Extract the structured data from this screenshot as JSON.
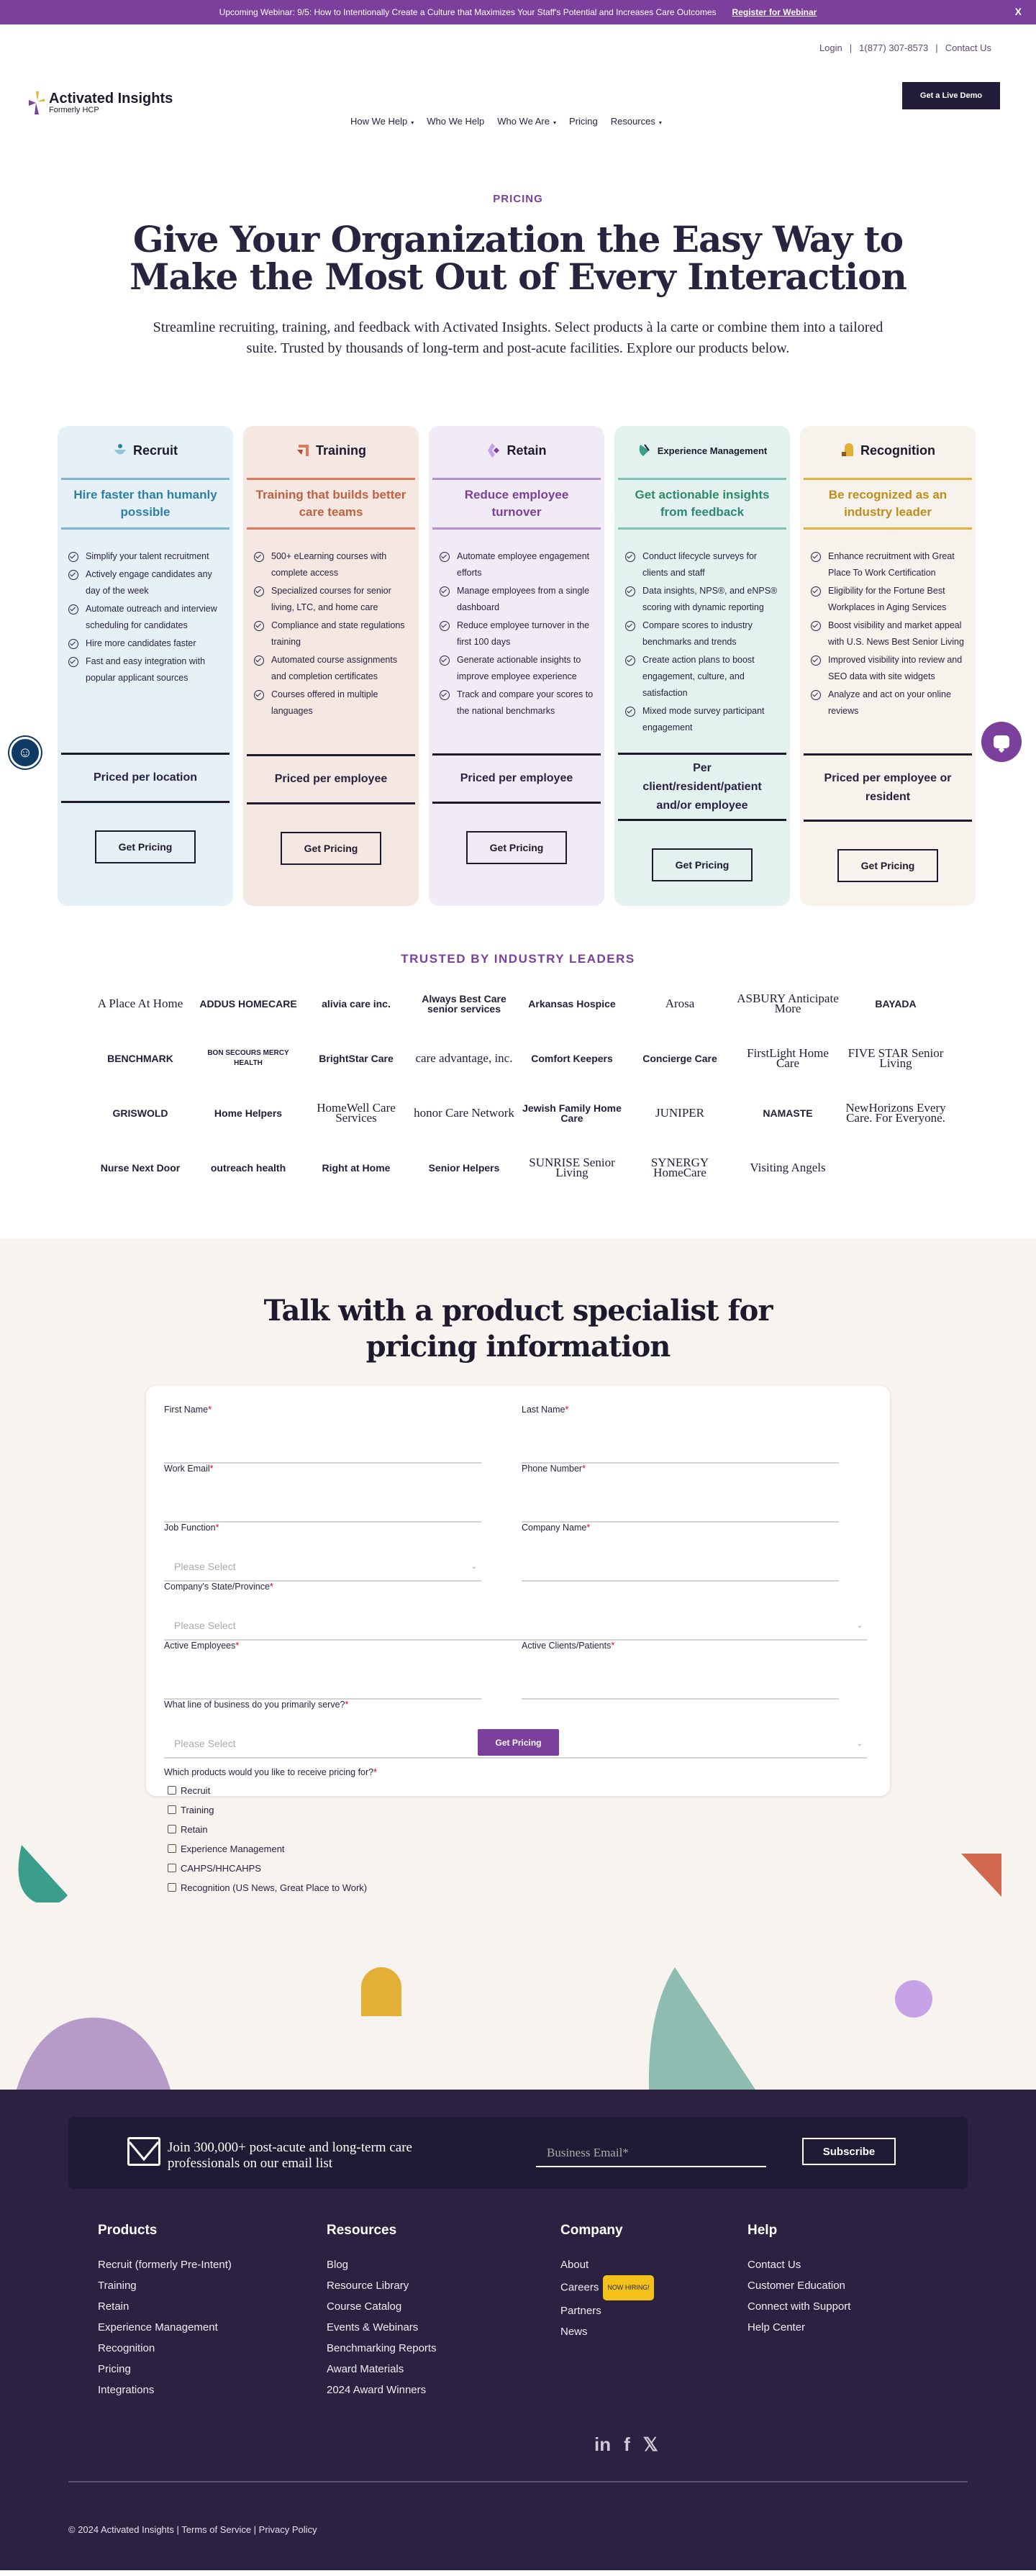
{
  "banner": {
    "text": "Upcoming Webinar: 9/5: How to Intentionally Create a Culture that Maximizes Your Staff's Potential and Increases Care Outcomes",
    "link": "Register for Webinar",
    "close": "X"
  },
  "utility": {
    "login": "Login",
    "phone": "1(877) 307-8573",
    "contact": "Contact Us"
  },
  "brand": {
    "name": "Activated Insights",
    "sub": "Formerly HCP"
  },
  "nav": {
    "items": [
      {
        "label": "How We Help",
        "caret": "▾"
      },
      {
        "label": "Who We Help",
        "caret": ""
      },
      {
        "label": "Who We Are",
        "caret": "▾"
      },
      {
        "label": "Pricing",
        "caret": ""
      },
      {
        "label": "Resources",
        "caret": "▾"
      }
    ],
    "demo": "Get a Live Demo"
  },
  "hero": {
    "eyebrow": "PRICING",
    "title": "Give Your Organization the Easy Way to Make the Most Out of Every Interaction",
    "subtitle": "Streamline recruiting, training, and feedback with Activated Insights. Select products à la carte or combine them into a tailored suite. Trusted by thousands of long-term and post-acute facilities. Explore our products below."
  },
  "cards": [
    {
      "name": "Recruit",
      "tagline": "Hire faster than humanly possible",
      "bg": "#e5f0f7",
      "accent": "#2e7fa8",
      "line": "#7fb6d6",
      "features": [
        "Simplify your talent recruitment",
        "Actively engage candidates any day of the week",
        "Automate outreach and interview scheduling for candidates",
        "Hire more candidates faster",
        "Fast and easy integration with popular applicant sources"
      ],
      "pricing": "Priced per location",
      "button": "Get Pricing"
    },
    {
      "name": "Training",
      "tagline": "Training that builds better care teams",
      "bg": "#f5e7e2",
      "accent": "#c2603f",
      "line": "#e07a5f",
      "features": [
        "500+ eLearning courses with complete access",
        "Specialized courses for senior living, LTC, and home care",
        "Compliance and state regulations training",
        "Automated course assignments and completion certificates",
        "Courses offered in multiple languages"
      ],
      "pricing": "Priced per employee",
      "button": "Get Pricing"
    },
    {
      "name": "Retain",
      "tagline": "Reduce employee turnover",
      "bg": "#f1ebf6",
      "accent": "#7b3f9c",
      "line": "#b38fd1",
      "features": [
        "Automate employee engagement efforts",
        "Manage employees from a single dashboard",
        "Reduce employee turnover in the first 100 days",
        "Generate actionable insights to improve employee experience",
        "Track and compare your scores to the national benchmarks"
      ],
      "pricing": "Priced per employee",
      "button": "Get Pricing"
    },
    {
      "name": "Experience Management",
      "tagline": "Get actionable insights from feedback",
      "bg": "#e3f2ef",
      "accent": "#2d8a6e",
      "line": "#7cc3b1",
      "features": [
        "Conduct lifecycle surveys for clients and staff",
        "Data insights, NPS®, and eNPS® scoring with dynamic reporting",
        "Compare scores to industry benchmarks and trends",
        "Create action plans to boost engagement, culture, and satisfaction",
        "Mixed mode survey participant engagement"
      ],
      "pricing": "Per client/resident/patient and/or employee",
      "button": "Get Pricing"
    },
    {
      "name": "Recognition",
      "tagline": "Be recognized as an industry leader",
      "bg": "#f7f3ec",
      "accent": "#c08d1a",
      "line": "#e2b13c",
      "features": [
        "Enhance recruitment with Great Place To Work Certification",
        "Eligibility for the Fortune Best Workplaces in Aging Services",
        "Boost visibility and market appeal with U.S. News Best Senior Living",
        "Improved visibility into review and SEO data with site widgets",
        "Analyze and act on your online reviews"
      ],
      "pricing": "Priced per employee or resident",
      "button": "Get Pricing"
    }
  ],
  "trusted": {
    "title": "TRUSTED BY INDUSTRY LEADERS",
    "logos": [
      "A Place At Home",
      "ADDUS HOMECARE",
      "alivia care inc.",
      "Always Best Care senior services",
      "Arkansas Hospice",
      "Arosa",
      "ASBURY Anticipate More",
      "BAYADA",
      "BENCHMARK",
      "BON SECOURS MERCY HEALTH",
      "BrightStar Care",
      "care advantage, inc.",
      "Comfort Keepers",
      "Concierge Care",
      "FirstLight Home Care",
      "FIVE STAR Senior Living",
      "GRISWOLD",
      "Home Helpers",
      "HomeWell Care Services",
      "honor Care Network",
      "Jewish Family Home Care",
      "JUNIPER",
      "NAMASTE",
      "NewHorizons Every Care. For Everyone.",
      "Nurse Next Door",
      "outreach health",
      "Right at Home",
      "Senior Helpers",
      "SUNRISE Senior Living",
      "SYNERGY HomeCare",
      "Visiting Angels",
      "Visiting Angels"
    ]
  },
  "contact": {
    "title": "Talk with a product specialist for pricing information",
    "fields": {
      "first_name": "First Name",
      "last_name": "Last Name",
      "work_email": "Work Email",
      "phone": "Phone Number",
      "job_function": "Job Function",
      "company_name": "Company Name",
      "state": "Company's State/Province",
      "employees": "Active Employees",
      "clients": "Active Clients/Patients",
      "business": "What line of business do you primarily serve?",
      "select_placeholder": "Please Select",
      "req": "*"
    },
    "products_question": "Which products would you like to receive pricing for?",
    "products": [
      "Recruit",
      "Training",
      "Retain",
      "Experience Management",
      "CAHPS/HHCAHPS",
      "Recognition (US News, Great Place to Work)"
    ],
    "submit": "Get Pricing"
  },
  "footer": {
    "newsletter": {
      "text": "Join 300,000+ post-acute and long-term care professionals on our email list",
      "placeholder": "Business Email*",
      "button": "Subscribe"
    },
    "columns": [
      {
        "title": "Products",
        "links": [
          "Recruit (formerly Pre-Intent)",
          "Training",
          "Retain",
          "Experience Management",
          "Recognition",
          "Pricing",
          "Integrations"
        ]
      },
      {
        "title": "Resources",
        "links": [
          "Blog",
          "Resource Library",
          "Course Catalog",
          "Events & Webinars",
          "Benchmarking Reports",
          "Award Materials",
          "2024 Award Winners"
        ]
      },
      {
        "title": "Company",
        "links": [
          "About",
          "Careers",
          "Partners",
          "News"
        ],
        "badge": "NOW HIRING!"
      },
      {
        "title": "Help",
        "links": [
          "Contact Us",
          "Customer Education",
          "Connect with Support",
          "Help Center"
        ]
      }
    ],
    "social": [
      "in",
      "f",
      "𝕏"
    ],
    "copyright": "© 2024 Activated Insights | Terms of Service | Privacy Policy"
  }
}
